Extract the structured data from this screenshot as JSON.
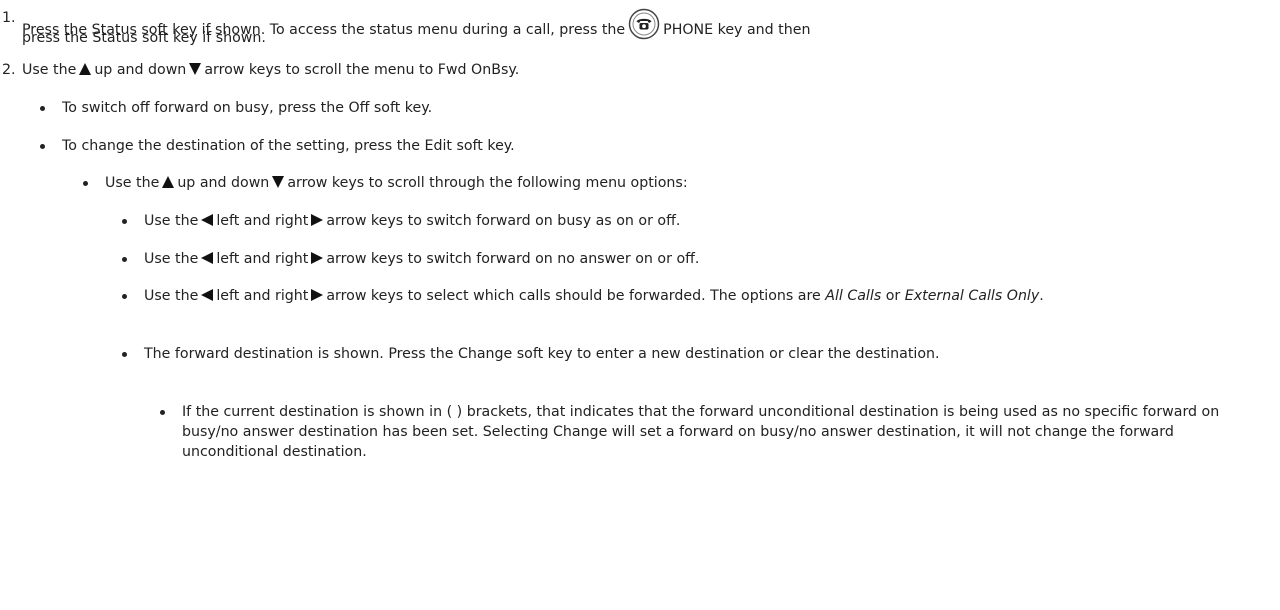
{
  "steps": [
    {
      "number": "1.",
      "text_a": "Press the Status soft key if shown. To access the status menu during a call, press the",
      "text_b": "PHONE key and then",
      "text_c": "press the Status soft key if shown."
    },
    {
      "number": "2.",
      "text_a": "Use the",
      "text_b": "up and down",
      "text_c": "arrow keys to scroll the menu to Fwd OnBsy."
    }
  ],
  "bullets": {
    "off": "To switch off forward on busy, press the Off soft key.",
    "edit": "To change the destination of the setting, press the Edit soft key.",
    "scroll": {
      "a": "Use the",
      "b": "up and down",
      "c": "arrow keys to scroll through the following menu options:"
    },
    "busy": {
      "a": "Use the",
      "b": "left and right",
      "c": "arrow keys to switch forward on busy as on or off."
    },
    "noanswer": {
      "a": "Use the",
      "b": "left and right",
      "c": "arrow keys to switch forward on no answer on or off."
    },
    "calls": {
      "a": "Use the",
      "b": "left and right",
      "c": "arrow keys to select which calls should be forwarded. The options are",
      "opt1": "All Calls",
      "or": "or",
      "opt2": "External Calls Only",
      "end": "."
    },
    "destination": "The forward destination is shown. Press the Change soft key to enter a new destination or clear the destination.",
    "brackets": "If the current destination is shown in ( ) brackets, that indicates that the forward unconditional destination is being used as no specific forward on busy/no answer destination has been set. Selecting Change will set a forward on busy/no answer destination, it will not change the forward unconditional destination."
  },
  "icons": {
    "phone_key": "phone-key-icon",
    "up": "up-arrow-icon",
    "down": "down-arrow-icon",
    "left": "left-arrow-icon",
    "right": "right-arrow-icon"
  }
}
